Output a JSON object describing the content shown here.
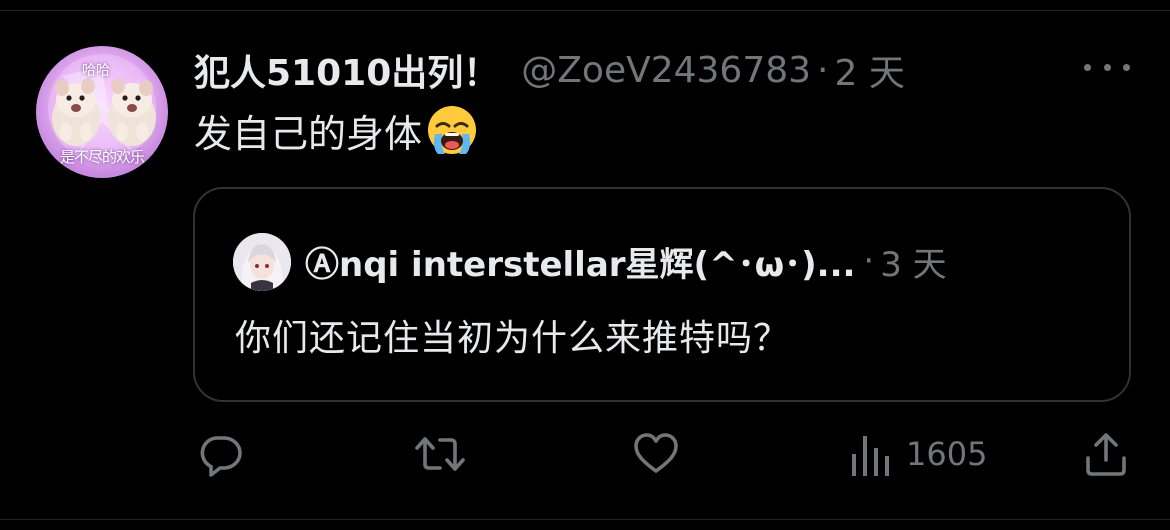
{
  "tweet": {
    "author": {
      "display_name": "犯人51010出列！",
      "handle": "@ZoeV2436783",
      "avatar_caption_top": "哈哈",
      "avatar_caption_bottom": "是不尽的欢乐"
    },
    "separator": "·",
    "time": "2 天",
    "text": "发自己的身体",
    "emoji": "loudly-crying-face",
    "more_icon": "more-horizontal-icon"
  },
  "quoted_tweet": {
    "display_name": "Ⓐnqi interstellar星辉(^･ω･)...",
    "separator": "·",
    "time": "3 天",
    "text": "你们还记住当初为什么来推特吗？"
  },
  "actions": {
    "reply_icon": "reply-icon",
    "retweet_icon": "retweet-icon",
    "like_icon": "heart-icon",
    "views_icon": "views-bar-chart-icon",
    "views_count": "1605",
    "share_icon": "share-icon"
  },
  "colors": {
    "background": "#000000",
    "primary_text": "#e7e9ea",
    "secondary_text": "#71767b",
    "border": "#2f3336"
  }
}
